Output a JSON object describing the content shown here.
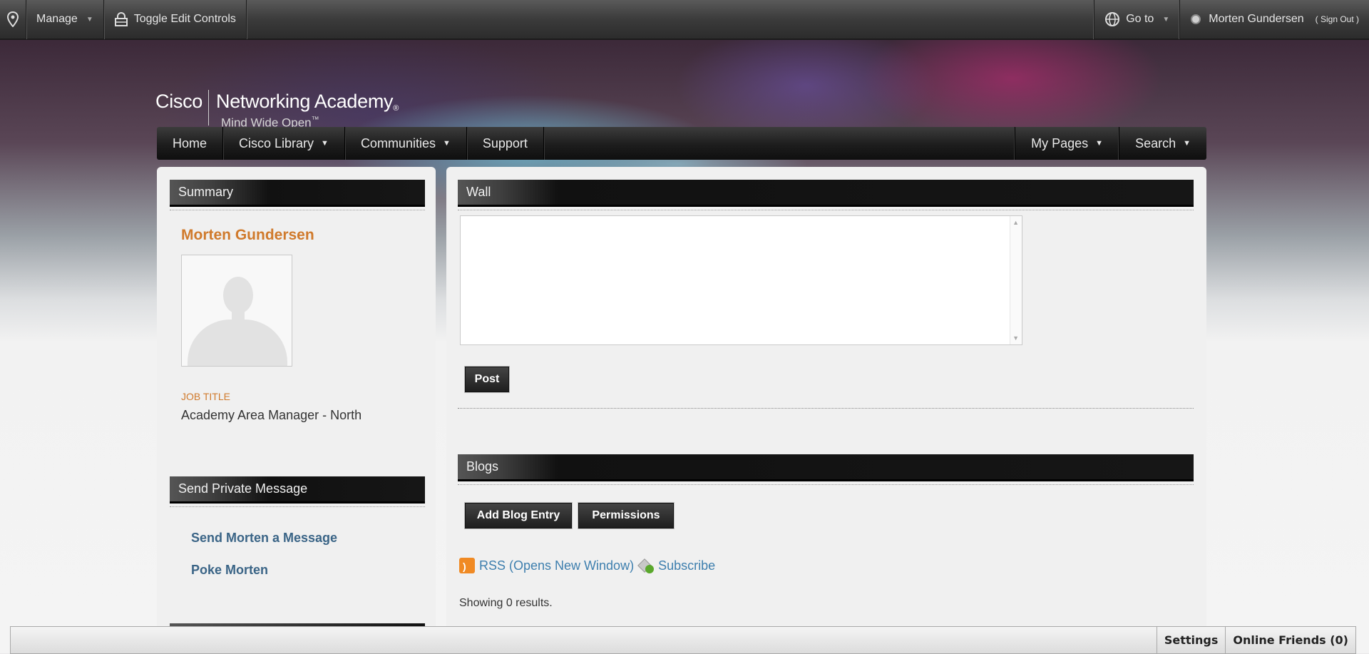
{
  "topbar": {
    "manage_label": "Manage",
    "toggle_label": "Toggle Edit Controls",
    "goto_label": "Go to",
    "user_name": "Morten Gundersen",
    "signout_label": "( Sign Out )"
  },
  "logo": {
    "brand": "Cisco",
    "product": "Networking Academy",
    "tagline": "Mind Wide Open"
  },
  "nav": {
    "items": [
      {
        "label": "Home"
      },
      {
        "label": "Cisco Library",
        "caret": "▼"
      },
      {
        "label": "Communities",
        "caret": "▼"
      },
      {
        "label": "Support"
      }
    ],
    "right_items": [
      {
        "label": "My Pages",
        "caret": "▼"
      },
      {
        "label": "Search",
        "caret": "▼"
      }
    ]
  },
  "summary": {
    "heading": "Summary",
    "name": "Morten Gundersen",
    "job_label": "JOB TITLE",
    "job_value": "Academy Area Manager - North"
  },
  "private_message": {
    "heading": "Send Private Message",
    "send_link": "Send Morten a Message",
    "poke_link": "Poke Morten"
  },
  "wall": {
    "heading": "Wall",
    "post_button": "Post"
  },
  "blogs": {
    "heading": "Blogs",
    "add_button": "Add Blog Entry",
    "permissions_button": "Permissions",
    "rss_link": "RSS (Opens New Window)",
    "subscribe_link": "Subscribe",
    "showing": "Showing 0 results."
  },
  "dock": {
    "settings": "Settings",
    "online_friends": "Online Friends (0)"
  }
}
